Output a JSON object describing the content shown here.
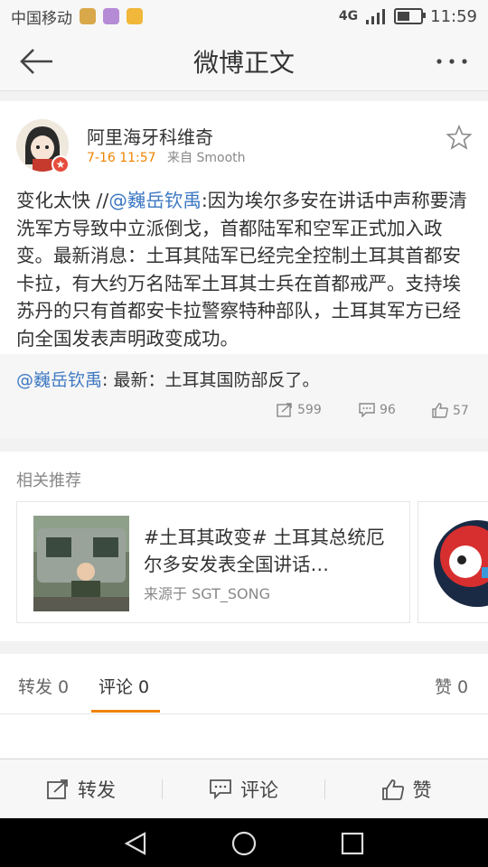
{
  "status_bar": {
    "carrier": "中国移动",
    "network": "4G",
    "network_small": "4G",
    "time": "11:59",
    "battery_level": 0.6
  },
  "header": {
    "title": "微博正文",
    "back_icon": "back-arrow-icon",
    "more_icon": "more-dots-icon"
  },
  "post": {
    "username": "阿里海牙科维奇",
    "time": "7-16 11:57",
    "source": "来自 Smooth",
    "text_prefix": "变化太快 //",
    "mention": "@巍岳钦禹",
    "text_body": ":因为埃尔多安在讲话中声称要清洗军方导致中立派倒戈，首都陆军和空军正式加入政变。最新消息：土耳其陆军已经完全控制土耳其首都安卡拉，有大约万名陆军土耳其士兵在首都戒严。支持埃苏丹的只有首都安卡拉警察特种部队，土耳其军方已经向全国发表声明政变成功。",
    "repost": {
      "mention": "@巍岳钦禹",
      "text": ": 最新：土耳其国防部反了。"
    },
    "stats": {
      "reposts": "599",
      "comments": "96",
      "likes": "57"
    }
  },
  "related": {
    "title": "相关推荐",
    "card": {
      "title": "#土耳其政变# 土耳其总统厄尔多安发表全国讲话…",
      "source": "来源于 SGT_SONG"
    }
  },
  "tabs": {
    "repost": "转发 0",
    "comment": "评论 0",
    "like": "赞 0"
  },
  "actions": {
    "repost": "转发",
    "comment": "评论",
    "like": "赞"
  },
  "colors": {
    "accent": "#f08300",
    "link": "#3c78c3",
    "vip_badge": "#e64c3c"
  }
}
